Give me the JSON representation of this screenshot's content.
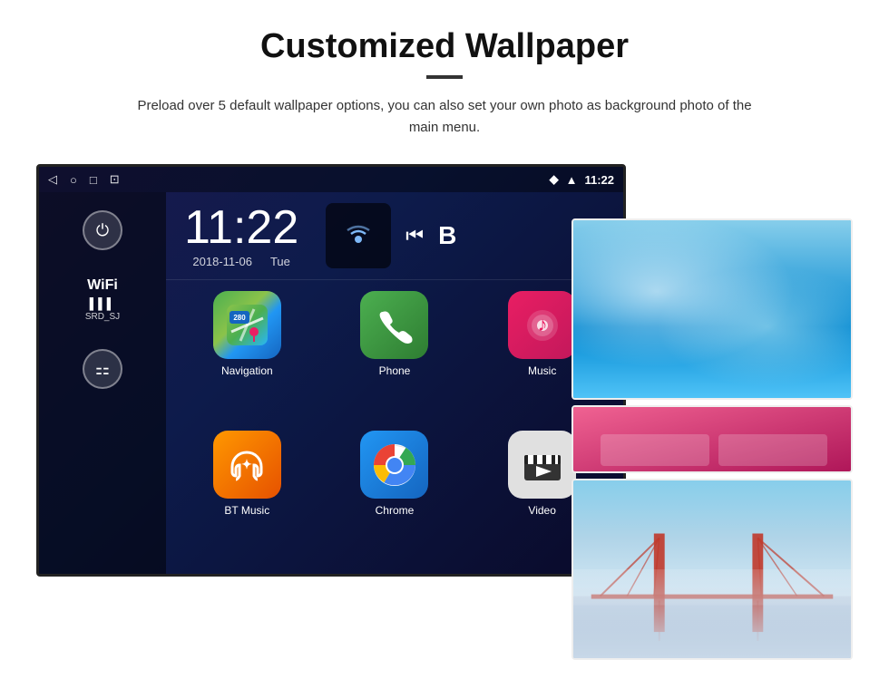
{
  "page": {
    "title": "Customized Wallpaper",
    "divider": true,
    "description": "Preload over 5 default wallpaper options, you can also set your own photo as background photo of the main menu."
  },
  "statusBar": {
    "time": "11:22",
    "icons": [
      "back-icon",
      "home-icon",
      "square-icon",
      "screenshot-icon"
    ],
    "rightIcons": [
      "location-icon",
      "wifi-icon"
    ]
  },
  "clock": {
    "time": "11:22",
    "date": "2018-11-06",
    "day": "Tue"
  },
  "wifi": {
    "label": "WiFi",
    "bars": "▌▌▌",
    "ssid": "SRD_SJ"
  },
  "apps": [
    {
      "id": "navigation",
      "label": "Navigation",
      "type": "nav"
    },
    {
      "id": "phone",
      "label": "Phone",
      "type": "phone"
    },
    {
      "id": "music",
      "label": "Music",
      "type": "music"
    },
    {
      "id": "btmusic",
      "label": "BT Music",
      "type": "bt"
    },
    {
      "id": "chrome",
      "label": "Chrome",
      "type": "chrome"
    },
    {
      "id": "video",
      "label": "Video",
      "type": "video"
    }
  ],
  "wallpapers": [
    {
      "id": "ice",
      "type": "ice",
      "label": "Ice blue wallpaper"
    },
    {
      "id": "pink",
      "type": "pink",
      "label": "Pink wallpaper partial"
    },
    {
      "id": "bridge",
      "type": "bridge",
      "label": "Golden gate bridge wallpaper"
    }
  ],
  "buttons": {
    "power": "⏻",
    "apps": "⠿"
  }
}
